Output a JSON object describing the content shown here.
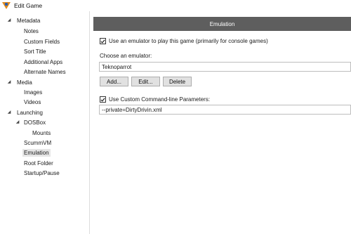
{
  "window": {
    "title": "Edit Game",
    "icon": "launchbox-icon"
  },
  "sidebar": {
    "tree": [
      {
        "label": "Metadata",
        "level": 0,
        "expanded": true
      },
      {
        "label": "Notes",
        "level": 1
      },
      {
        "label": "Custom Fields",
        "level": 1
      },
      {
        "label": "Sort Title",
        "level": 1
      },
      {
        "label": "Additional Apps",
        "level": 1
      },
      {
        "label": "Alternate Names",
        "level": 1
      },
      {
        "label": "Media",
        "level": 0,
        "expanded": true
      },
      {
        "label": "Images",
        "level": 1
      },
      {
        "label": "Videos",
        "level": 1
      },
      {
        "label": "Launching",
        "level": 0,
        "expanded": true
      },
      {
        "label": "DOSBox",
        "level": 1,
        "expanded": true
      },
      {
        "label": "Mounts",
        "level": 2
      },
      {
        "label": "ScummVM",
        "level": 1
      },
      {
        "label": "Emulation",
        "level": 1,
        "selected": true
      },
      {
        "label": "Root Folder",
        "level": 1
      },
      {
        "label": "Startup/Pause",
        "level": 1
      }
    ]
  },
  "main": {
    "header": "Emulation",
    "use_emulator": {
      "checked": true,
      "label": "Use an emulator to play this game (primarily for console games)"
    },
    "choose_emulator_label": "Choose an emulator:",
    "emulator_value": "Teknoparrot",
    "buttons": {
      "add": "Add...",
      "edit": "Edit...",
      "delete": "Delete"
    },
    "use_custom_params": {
      "checked": true,
      "label": "Use Custom Command-line Parameters:"
    },
    "params_value": "--private=DirtyDrivin.xml"
  },
  "colors": {
    "header_bg": "#5e5e5e",
    "header_text": "#ffffff",
    "selected_bg": "#e5e5e5",
    "button_bg": "#e1e1e1"
  }
}
